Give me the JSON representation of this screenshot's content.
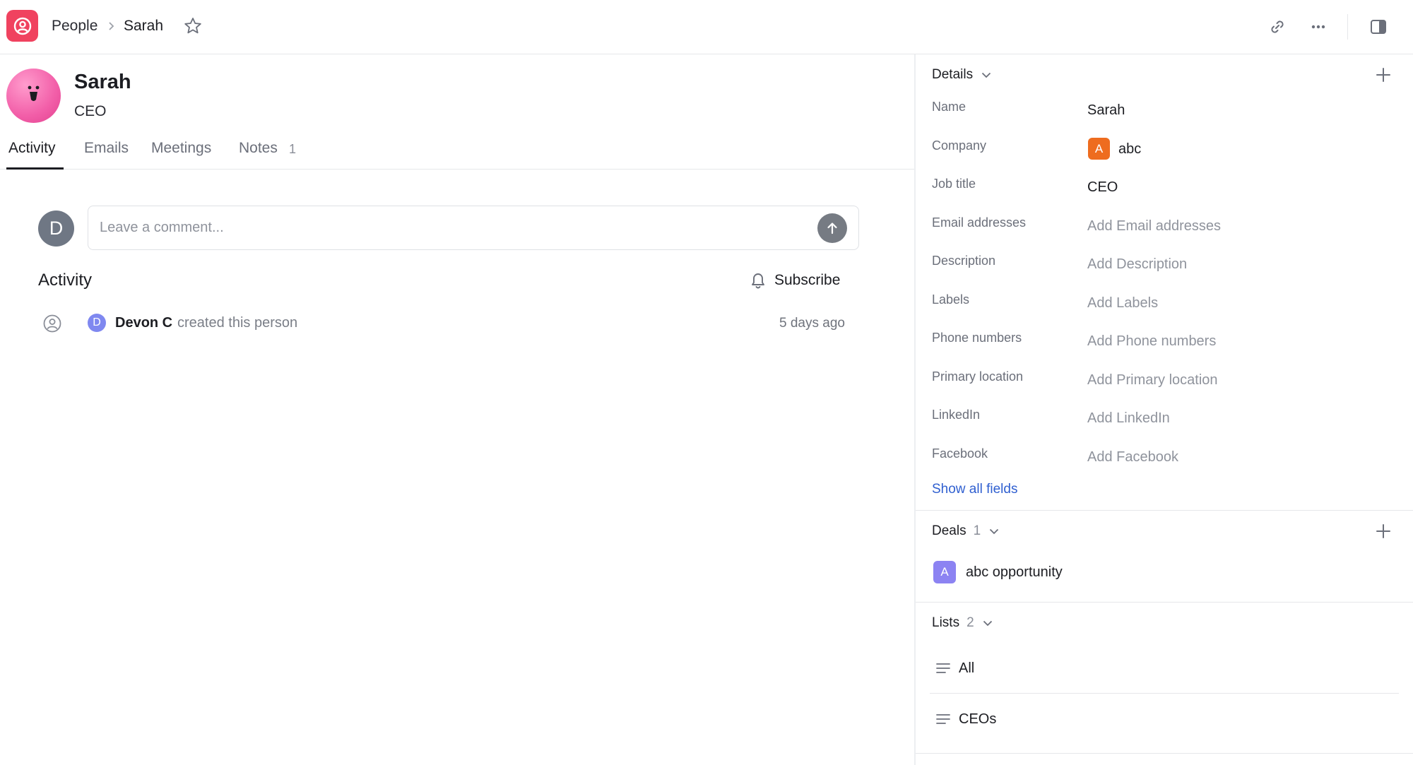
{
  "breadcrumb": {
    "parent": "People",
    "current": "Sarah"
  },
  "person": {
    "name": "Sarah",
    "title": "CEO"
  },
  "tabs": [
    {
      "label": "Activity"
    },
    {
      "label": "Emails"
    },
    {
      "label": "Meetings"
    },
    {
      "label": "Notes",
      "count": "1"
    }
  ],
  "comment": {
    "avatar_initial": "D",
    "placeholder": "Leave a comment..."
  },
  "activity": {
    "heading": "Activity",
    "subscribe_label": "Subscribe",
    "items": [
      {
        "avatar_initial": "D",
        "actor": "Devon C",
        "action": "created this person",
        "time": "5 days ago"
      }
    ]
  },
  "details": {
    "heading": "Details",
    "fields": [
      {
        "label": "Name",
        "value": "Sarah"
      },
      {
        "label": "Company",
        "value": "abc",
        "badge": "A"
      },
      {
        "label": "Job title",
        "value": "CEO"
      },
      {
        "label": "Email addresses",
        "value": "Add Email addresses"
      },
      {
        "label": "Description",
        "value": "Add Description"
      },
      {
        "label": "Labels",
        "value": "Add Labels"
      },
      {
        "label": "Phone numbers",
        "value": "Add Phone numbers"
      },
      {
        "label": "Primary location",
        "value": "Add Primary location"
      },
      {
        "label": "LinkedIn",
        "value": "Add LinkedIn"
      },
      {
        "label": "Facebook",
        "value": "Add Facebook"
      }
    ],
    "show_all": "Show all fields"
  },
  "deals": {
    "heading": "Deals",
    "count": "1",
    "items": [
      {
        "badge": "A",
        "name": "abc opportunity"
      }
    ]
  },
  "lists": {
    "heading": "Lists",
    "count": "2",
    "items": [
      {
        "name": "All"
      },
      {
        "name": "CEOs"
      }
    ]
  },
  "colors": {
    "logo": "#f0425f",
    "company_badge": "#ee6c1f",
    "deal_badge": "#8c83f2",
    "link": "#2f5fd0"
  }
}
